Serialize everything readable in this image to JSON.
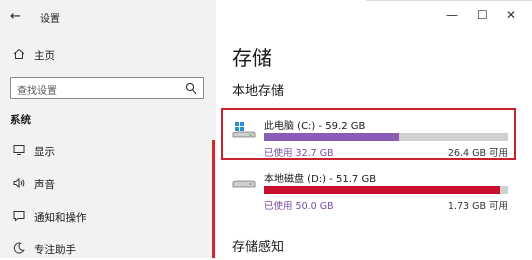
{
  "window": {
    "title": "设置",
    "back_glyph": "←",
    "minimize_glyph": "—",
    "maximize_glyph": "☐",
    "close_glyph": "✕"
  },
  "sidebar": {
    "home_label": "主页",
    "search_placeholder": "查找设置",
    "section_label": "系统",
    "items": [
      {
        "label": "显示",
        "icon": "monitor-icon"
      },
      {
        "label": "声音",
        "icon": "speaker-icon"
      },
      {
        "label": "通知和操作",
        "icon": "notification-icon"
      },
      {
        "label": "专注助手",
        "icon": "moon-icon"
      }
    ]
  },
  "main": {
    "title": "存储",
    "local_storage_heading": "本地存储",
    "storage_sense_heading": "存储感知",
    "drives": [
      {
        "name": "此电脑 (C:) - 59.2 GB",
        "used": "已使用 32.7 GB",
        "free": "26.4 GB 可用",
        "used_fraction": 0.5524,
        "bar_color": "#8a5cb5",
        "highlighted": true
      },
      {
        "name": "本地磁盘 (D:) - 51.7 GB",
        "used": "已使用 50.0 GB",
        "free": "1.73 GB 可用",
        "used_fraction": 0.9671,
        "bar_color": "#c8102e",
        "highlighted": false
      }
    ]
  },
  "colors": {
    "sidebar_bg": "#f2f2f2",
    "highlight_border": "#c8232c",
    "bar_track": "#cfcfcf"
  }
}
